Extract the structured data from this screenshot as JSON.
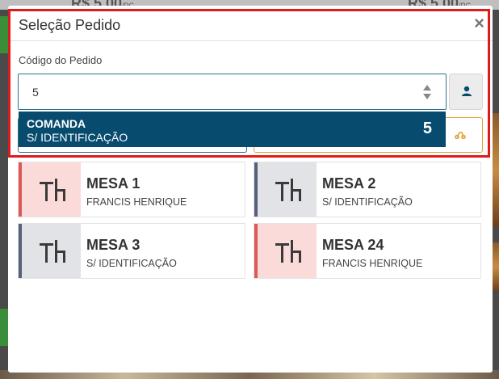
{
  "background": {
    "price_left": "R$ 5.00",
    "price_right": "R$ 5.00",
    "price_unit": "/PC"
  },
  "modal": {
    "title": "Seleção Pedido",
    "close_symbol": "×"
  },
  "form": {
    "label": "Código do Pedido",
    "value": "5",
    "person_icon": "person-icon"
  },
  "suggestion": {
    "title": "COMANDA",
    "subtitle": "S/ IDENTIFICAÇÃO",
    "number": "5"
  },
  "tables": [
    {
      "name": "MESA 1",
      "customer": "FRANCIS HENRIQUE",
      "accent": "#e05757",
      "tint": "#fbdada"
    },
    {
      "name": "MESA 2",
      "customer": "S/ IDENTIFICAÇÃO",
      "accent": "#56607a",
      "tint": "#e1e3e7"
    },
    {
      "name": "MESA 3",
      "customer": "S/ IDENTIFICAÇÃO",
      "accent": "#56607a",
      "tint": "#e1e3e7"
    },
    {
      "name": "MESA 24",
      "customer": "FRANCIS HENRIQUE",
      "accent": "#e05757",
      "tint": "#fbdada"
    }
  ],
  "colors": {
    "primary": "#074b6e",
    "highlight": "#e0191d",
    "warning": "#e2a234"
  }
}
